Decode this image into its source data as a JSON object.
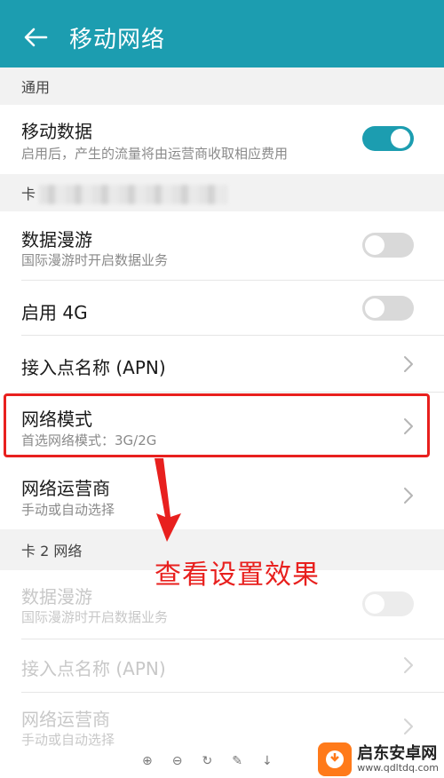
{
  "header": {
    "title": "移动网络"
  },
  "sections": {
    "general": "通用",
    "card1_prefix": "卡",
    "card2": "卡 2 网络"
  },
  "mobile_data": {
    "title": "移动数据",
    "subtitle": "启用后，产生的流量将由运营商收取相应费用",
    "enabled": true
  },
  "card1": {
    "roaming": {
      "title": "数据漫游",
      "subtitle": "国际漫游时开启数据业务",
      "enabled": false
    },
    "enable_4g": {
      "title": "启用 4G",
      "enabled": false
    },
    "apn": {
      "title": "接入点名称 (APN)"
    },
    "network_mode": {
      "title": "网络模式",
      "subtitle": "首选网络模式：3G/2G"
    },
    "operator": {
      "title": "网络运营商",
      "subtitle": "手动或自动选择"
    }
  },
  "card2": {
    "roaming": {
      "title": "数据漫游",
      "subtitle": "国际漫游时开启数据业务",
      "enabled": false
    },
    "apn": {
      "title": "接入点名称 (APN)"
    },
    "operator": {
      "title": "网络运营商",
      "subtitle": "手动或自动选择"
    }
  },
  "annotation": {
    "text": "查看设置效果"
  },
  "watermark": {
    "name": "启东安卓网",
    "url": "www.qdltdq.com"
  },
  "colors": {
    "accent": "#1c9db0",
    "highlight": "#e8201e",
    "watermark": "#ff7a1a"
  }
}
